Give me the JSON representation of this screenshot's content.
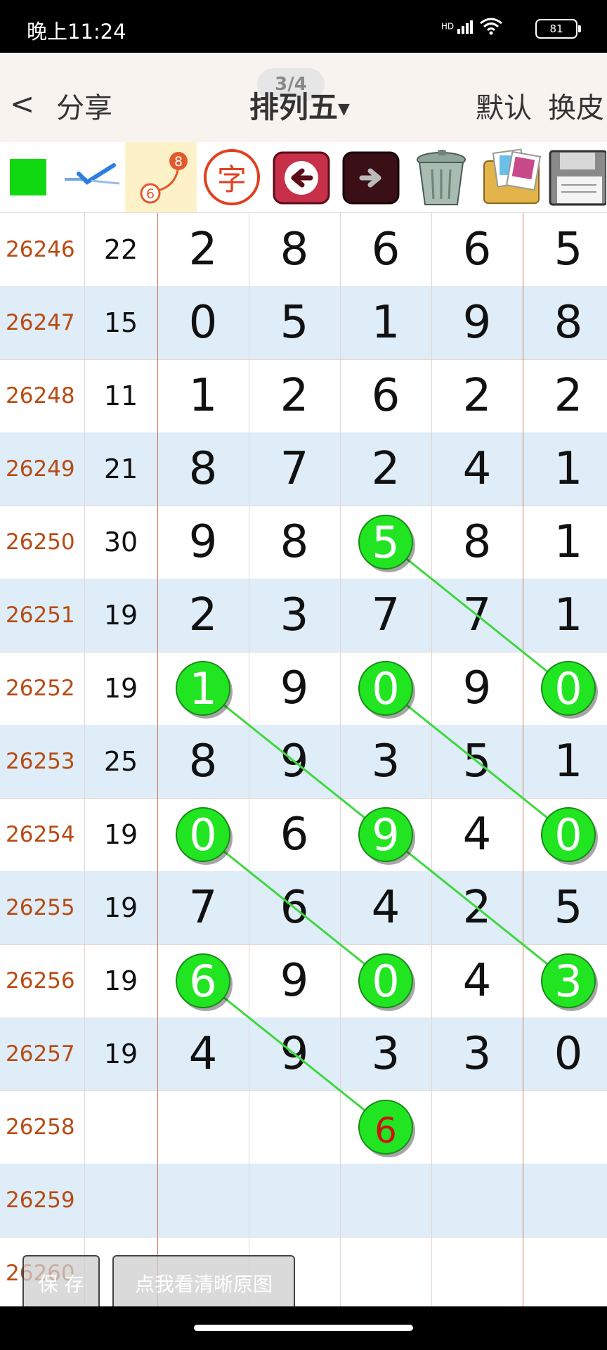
{
  "status_bar": {
    "time": "晚上11:24",
    "signal": "HD",
    "battery": "81"
  },
  "header": {
    "back_label": "<",
    "share_label": "分享",
    "title": "排列五",
    "page_indicator": "3/4",
    "default_label": "默认",
    "skin_label": "换皮"
  },
  "toolbar": {
    "mark_badge_top": "8",
    "mark_badge_bottom": "6",
    "char_label": "字",
    "items": [
      "color-swatch-icon",
      "check-icon",
      "connect-points-icon",
      "char-icon",
      "undo-arrow-icon",
      "redo-arrow-icon",
      "trash-icon",
      "gallery-icon",
      "save-disk-icon"
    ]
  },
  "rows": [
    {
      "issue": "26246",
      "sum": "22",
      "digits": [
        "2",
        "8",
        "6",
        "6",
        "5"
      ]
    },
    {
      "issue": "26247",
      "sum": "15",
      "digits": [
        "0",
        "5",
        "1",
        "9",
        "8"
      ]
    },
    {
      "issue": "26248",
      "sum": "11",
      "digits": [
        "1",
        "2",
        "6",
        "2",
        "2"
      ]
    },
    {
      "issue": "26249",
      "sum": "21",
      "digits": [
        "8",
        "7",
        "2",
        "4",
        "1"
      ]
    },
    {
      "issue": "26250",
      "sum": "30",
      "digits": [
        "9",
        "8",
        "5",
        "8",
        "1"
      ]
    },
    {
      "issue": "26251",
      "sum": "19",
      "digits": [
        "2",
        "3",
        "7",
        "7",
        "1"
      ]
    },
    {
      "issue": "26252",
      "sum": "19",
      "digits": [
        "1",
        "9",
        "0",
        "9",
        "0"
      ]
    },
    {
      "issue": "26253",
      "sum": "25",
      "digits": [
        "8",
        "9",
        "3",
        "5",
        "1"
      ]
    },
    {
      "issue": "26254",
      "sum": "19",
      "digits": [
        "0",
        "6",
        "9",
        "4",
        "0"
      ]
    },
    {
      "issue": "26255",
      "sum": "19",
      "digits": [
        "7",
        "6",
        "4",
        "2",
        "5"
      ]
    },
    {
      "issue": "26256",
      "sum": "19",
      "digits": [
        "6",
        "9",
        "0",
        "4",
        "3"
      ]
    },
    {
      "issue": "26257",
      "sum": "19",
      "digits": [
        "4",
        "9",
        "3",
        "3",
        "0"
      ]
    },
    {
      "issue": "26258",
      "sum": "",
      "digits": [
        "",
        "",
        "6",
        "",
        ""
      ]
    },
    {
      "issue": "26259",
      "sum": "",
      "digits": [
        "",
        "",
        "",
        "",
        ""
      ]
    },
    {
      "issue": "26260",
      "sum": "",
      "digits": [
        "",
        "",
        "",
        "",
        ""
      ]
    }
  ],
  "highlights": [
    {
      "row": 4,
      "col": 2,
      "digit": "5",
      "predicted": false
    },
    {
      "row": 6,
      "col": 0,
      "digit": "1",
      "predicted": false
    },
    {
      "row": 6,
      "col": 2,
      "digit": "0",
      "predicted": false
    },
    {
      "row": 6,
      "col": 4,
      "digit": "0",
      "predicted": false
    },
    {
      "row": 8,
      "col": 0,
      "digit": "0",
      "predicted": false
    },
    {
      "row": 8,
      "col": 2,
      "digit": "9",
      "predicted": false
    },
    {
      "row": 8,
      "col": 4,
      "digit": "0",
      "predicted": false
    },
    {
      "row": 10,
      "col": 0,
      "digit": "6",
      "predicted": false
    },
    {
      "row": 10,
      "col": 2,
      "digit": "0",
      "predicted": false
    },
    {
      "row": 10,
      "col": 4,
      "digit": "3",
      "predicted": false
    },
    {
      "row": 12,
      "col": 2,
      "digit": "6",
      "predicted": true
    }
  ],
  "lines": [
    {
      "from": [
        4,
        2
      ],
      "to": [
        6,
        4
      ]
    },
    {
      "from": [
        6,
        0
      ],
      "to": [
        8,
        2
      ]
    },
    {
      "from": [
        8,
        2
      ],
      "to": [
        10,
        4
      ]
    },
    {
      "from": [
        6,
        2
      ],
      "to": [
        8,
        4
      ]
    },
    {
      "from": [
        8,
        0
      ],
      "to": [
        10,
        2
      ]
    },
    {
      "from": [
        10,
        0
      ],
      "to": [
        12,
        2
      ]
    }
  ],
  "buttons": {
    "save_label": "保 存",
    "view_original_label": "点我看清晰原图"
  },
  "colors": {
    "highlight": "#22e522",
    "line": "#3fd83f",
    "issue_text": "#b84b14",
    "alt_row": "#dfedf8",
    "predicted_digit": "#d01010"
  }
}
